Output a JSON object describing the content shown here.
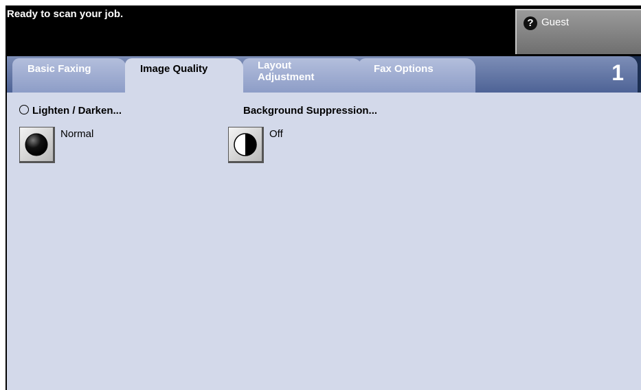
{
  "header": {
    "status": "Ready to scan your job.",
    "user_button": {
      "icon": "help-icon",
      "icon_glyph": "?",
      "label": "Guest"
    }
  },
  "tabs": [
    {
      "label": "Basic Faxing",
      "active": false
    },
    {
      "label": "Image Quality",
      "active": true
    },
    {
      "label": "Layout Adjustment",
      "active": false
    },
    {
      "label": "Fax Options",
      "active": false
    }
  ],
  "page_number": "1",
  "options": {
    "lighten_darken": {
      "title": "Lighten / Darken...",
      "value": "Normal",
      "icon": "lighten-darken-icon"
    },
    "background_suppression": {
      "title": "Background Suppression...",
      "value": "Off",
      "icon": "background-suppression-icon"
    }
  },
  "colors": {
    "panel_background": "#d3d9ea",
    "tab_inactive": "#8d9dc7",
    "tab_strip": "#4e6396",
    "header_background": "#000000"
  }
}
